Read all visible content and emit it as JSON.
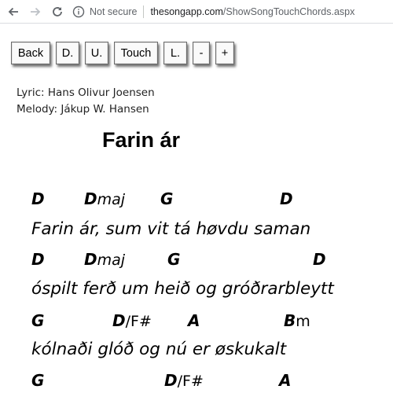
{
  "browser": {
    "security_label": "Not secure",
    "url_host": "thesongapp.com",
    "url_path": "/ShowSongTouchChords.aspx"
  },
  "toolbar": {
    "back": "Back",
    "down": "D.",
    "up": "U.",
    "touch": "Touch",
    "left": "L.",
    "minus": "-",
    "plus": "+"
  },
  "credits": {
    "lyric": "Lyric: Hans Olivur Joensen",
    "melody": "Melody: Jákup W. Hansen"
  },
  "song": {
    "title": "Farin ár",
    "lines": [
      {
        "chords": [
          {
            "root": "D",
            "suffix": ""
          },
          {
            "root": "D",
            "suffix": "maj"
          },
          {
            "root": "G",
            "suffix": ""
          },
          {
            "root": "D",
            "suffix": ""
          }
        ],
        "lyric": "Farin ár, sum vit tá høvdu saman"
      },
      {
        "chords": [
          {
            "root": "D",
            "suffix": ""
          },
          {
            "root": "D",
            "suffix": "maj"
          },
          {
            "root": "G",
            "suffix": ""
          },
          {
            "root": "D",
            "suffix": ""
          }
        ],
        "lyric": "óspilt ferð um heið og gróðrarbleytt"
      },
      {
        "chords": [
          {
            "root": "G",
            "suffix": ""
          },
          {
            "root": "D",
            "suffix": "/F#"
          },
          {
            "root": "A",
            "suffix": ""
          },
          {
            "root": "B",
            "suffix": "m"
          }
        ],
        "lyric": "kólnaði glóð og nú er øskukalt"
      },
      {
        "chords": [
          {
            "root": "G",
            "suffix": ""
          },
          {
            "root": "D",
            "suffix": "/F#"
          },
          {
            "root": "A",
            "suffix": ""
          }
        ],
        "lyric": ""
      }
    ]
  }
}
